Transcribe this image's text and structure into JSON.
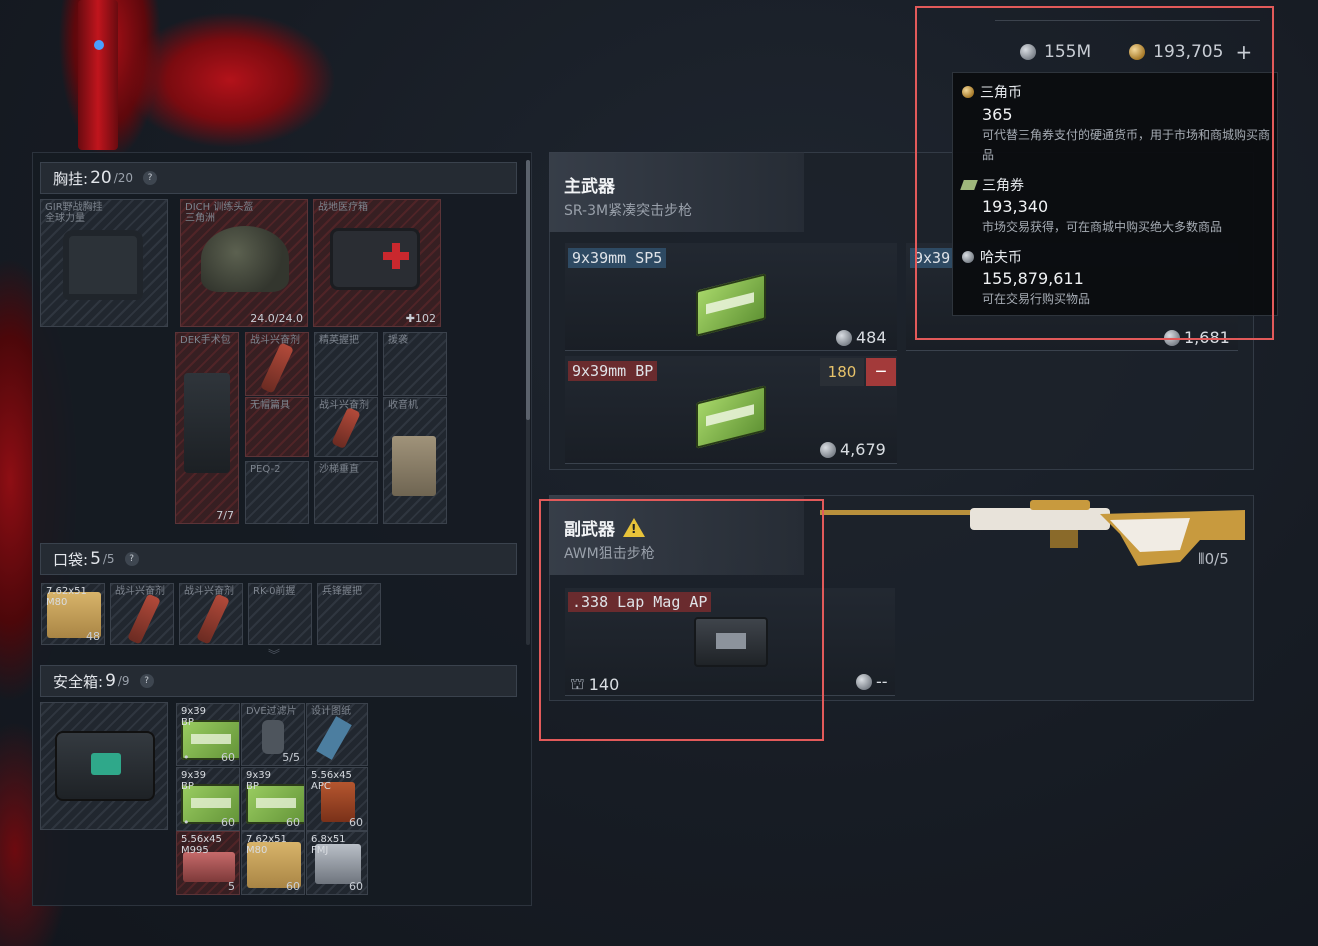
{
  "currency_bar": {
    "haf": "155M",
    "delta": "193,705",
    "plus": "+"
  },
  "tooltip": {
    "items": [
      {
        "name": "三角币",
        "value": "365",
        "desc": "可代替三角券支付的硬通货币，用于市场和商城购买商品"
      },
      {
        "name": "三角券",
        "value": "193,340",
        "desc": "市场交易获得，可在商城中购买绝大多数商品"
      },
      {
        "name": "哈夫币",
        "value": "155,879,611",
        "desc": "可在交易行购买物品"
      }
    ]
  },
  "chest_rig": {
    "label": "胸挂:",
    "count": "20",
    "max": "/20"
  },
  "chest_slots": {
    "vest": {
      "label": "GIR野战胸挂\n全球力量"
    },
    "helmet": {
      "label": "DICH 训练头盔\n三角洲",
      "num": "24.0/24.0"
    },
    "medkit": {
      "label": "战地医疗箱",
      "num": "✚102"
    },
    "surgery": {
      "label": "DEK手术包",
      "num": "7/7"
    },
    "stim1": {
      "label": "战斗兴奋剂"
    },
    "grip1": {
      "label": "精英握把"
    },
    "cover": {
      "label": "援袭"
    },
    "hat": {
      "label": "无帽篇具"
    },
    "stim2": {
      "label": "战斗兴奋剂"
    },
    "radio": {
      "label": "收音机"
    },
    "peq": {
      "label": "PEQ-2"
    },
    "stock": {
      "label": "沙梯垂直"
    }
  },
  "pocket": {
    "label": "口袋:",
    "count": "5",
    "max": "/5"
  },
  "pocket_slots": [
    {
      "label": "7.62x51\nM80",
      "num": "48"
    },
    {
      "label": "战斗兴奋剂",
      "num": ""
    },
    {
      "label": "战斗兴奋剂",
      "num": ""
    },
    {
      "label": "RK-0前握",
      "num": ""
    },
    {
      "label": "兵锋握把",
      "num": ""
    }
  ],
  "safe_box": {
    "label": "安全箱:",
    "count": "9",
    "max": "/9"
  },
  "safe_slots": [
    {
      "label": "9x39\nBP",
      "num": "60",
      "nl": "•"
    },
    {
      "label": "DVE过滤片",
      "num": "5/5",
      "nl": ""
    },
    {
      "label": "设计图纸",
      "num": "",
      "nl": ""
    },
    {
      "label": "9x39\nBP",
      "num": "60",
      "nl": "•"
    },
    {
      "label": "9x39\nBP",
      "num": "60",
      "nl": ""
    },
    {
      "label": "5.56x45\nAPC",
      "num": "60",
      "nl": ""
    },
    {
      "label": "5.56x45\nM995",
      "num": "5",
      "nl": ""
    },
    {
      "label": "7.62x51\nM80",
      "num": "60",
      "nl": ""
    },
    {
      "label": "6.8x51\nFMJ",
      "num": "60",
      "nl": ""
    }
  ],
  "main_weapon": {
    "title": "主武器",
    "name": "SR-3M紧凑突击步枪",
    "ammo": [
      {
        "tag": "9x39mm SP5",
        "price": "484"
      },
      {
        "tag": "9x39",
        "price": "1,681"
      },
      {
        "tag": "9x39mm BP",
        "price": "4,679",
        "qty": "180",
        "minus": "−"
      }
    ]
  },
  "secondary_weapon": {
    "title": "副武器",
    "name": "AWM狙击步枪",
    "mag": "0/5",
    "ammo": {
      "tag": ".338 Lap Mag AP",
      "count": "140",
      "price": "--"
    }
  }
}
